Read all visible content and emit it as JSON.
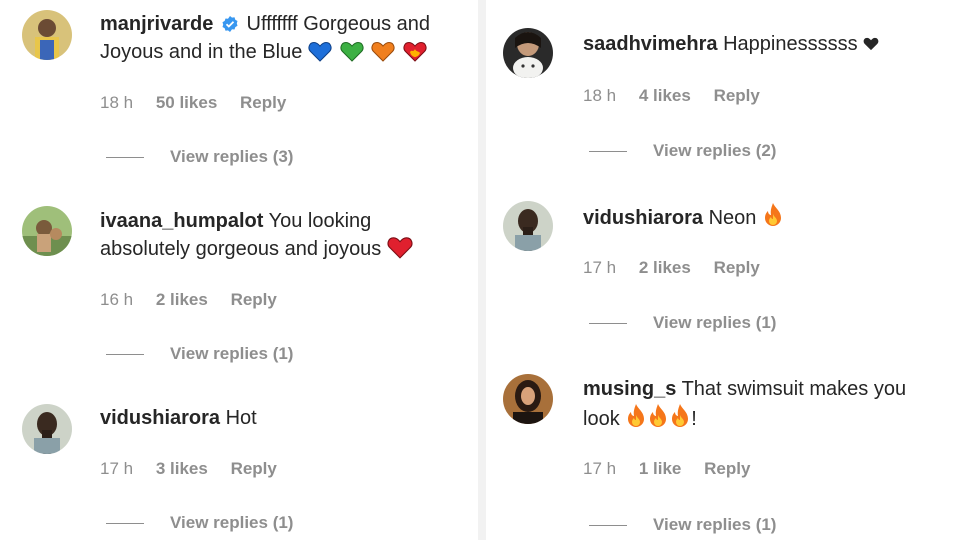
{
  "left": [
    {
      "username": "manjrivarde",
      "verified": true,
      "line1": "Ufffffff Gorgeous and",
      "line2": "Joyous and in the Blue",
      "time": "18 h",
      "likes": "50 likes",
      "reply": "Reply",
      "view_replies": "View replies (3)"
    },
    {
      "username": "ivaana_humpalot",
      "line1": "You looking",
      "line2": "absolutely gorgeous and joyous",
      "time": "16 h",
      "likes": "2 likes",
      "reply": "Reply",
      "view_replies": "View replies (1)"
    },
    {
      "username": "vidushiarora",
      "line1": "Hot",
      "time": "17 h",
      "likes": "3 likes",
      "reply": "Reply",
      "view_replies": "View replies (1)"
    }
  ],
  "right": [
    {
      "username": "saadhvimehra",
      "line1": "Happinessssss",
      "time": "18 h",
      "likes": "4 likes",
      "reply": "Reply",
      "view_replies": "View replies (2)"
    },
    {
      "username": "vidushiarora",
      "line1": "Neon",
      "time": "17 h",
      "likes": "2 likes",
      "reply": "Reply",
      "view_replies": "View replies (1)"
    },
    {
      "username": "musing_s",
      "line1": "That swimsuit makes you",
      "line2_prefix": "look",
      "line2_suffix": "!",
      "time": "17 h",
      "likes": "1 like",
      "reply": "Reply",
      "view_replies": "View replies (1)"
    }
  ],
  "colors": {
    "text": "#262626",
    "secondary": "#8e8e8e",
    "verified": "#3897f0",
    "heart_red": "#e0202e",
    "heart_blue": "#1e6fd9",
    "heart_green": "#3cb043",
    "heart_orange": "#f07f1e",
    "fire": "#f5761a"
  },
  "icons": [
    "verified-badge-icon",
    "blue-heart-icon",
    "green-heart-icon",
    "orange-heart-icon",
    "heart-on-fire-icon",
    "red-heart-icon",
    "black-heart-icon",
    "fire-icon"
  ]
}
